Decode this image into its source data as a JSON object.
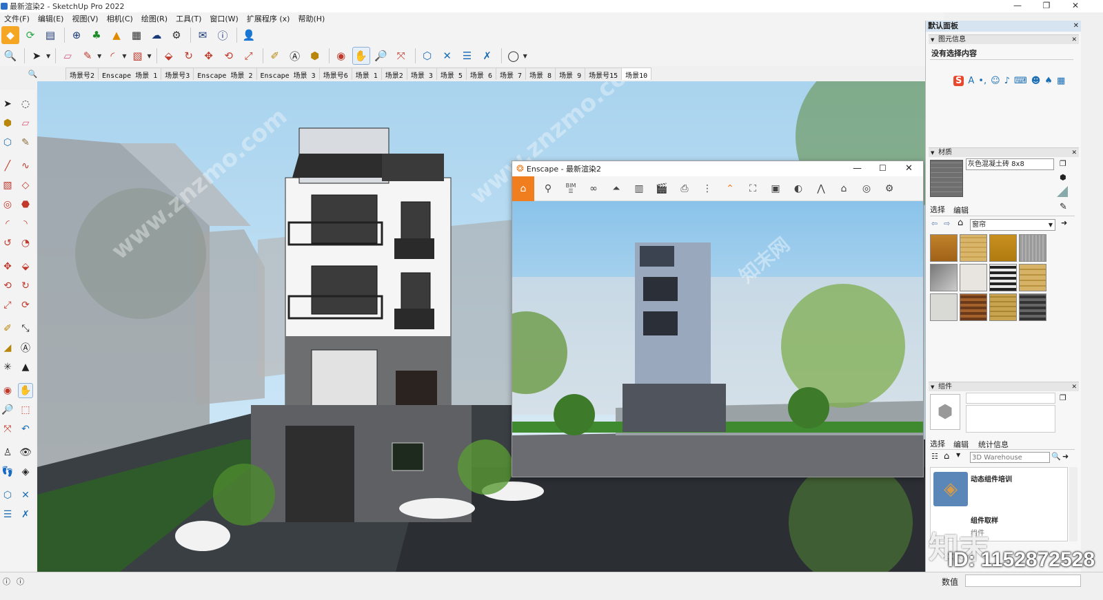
{
  "window": {
    "title": "最新渲染2 - SketchUp Pro 2022",
    "controls": [
      "—",
      "❐",
      "✕"
    ]
  },
  "menu": [
    "文件(F)",
    "编辑(E)",
    "视图(V)",
    "相机(C)",
    "绘图(R)",
    "工具(T)",
    "窗口(W)",
    "扩展程序 (x)",
    "帮助(H)"
  ],
  "scene_tabs": [
    "场景号2",
    "Enscape 场景 1",
    "场景号3",
    "Enscape 场景 2",
    "Enscape 场景 3",
    "场景号6",
    "场景 1",
    "场景2",
    "场景 3",
    "场景 5",
    "场景 6",
    "场景 7",
    "场景 8",
    "场景 9",
    "场景号15",
    "场景10"
  ],
  "active_scene_tab": "场景10",
  "enscape": {
    "title": "Enscape - 最新渲染2",
    "bim_label": "BIM"
  },
  "panel": {
    "title": "默认面板",
    "entity_info": {
      "header": "图元信息",
      "text": "没有选择内容"
    },
    "materials": {
      "header": "材质",
      "material_name": "灰色混凝土砖 8x8",
      "tab_select": "选择",
      "tab_edit": "编辑",
      "category": "窗帘"
    },
    "components": {
      "header": "组件",
      "tab_select": "选择",
      "tab_edit": "编辑",
      "tab_stats": "统计信息",
      "search_placeholder": "3D Warehouse",
      "item1": "动态组件培训",
      "item2": "组件取样",
      "item3": "组件"
    }
  },
  "status": {
    "value_label": "数值"
  },
  "watermark": {
    "id": "ID: 1152872528",
    "logo_text": "知末",
    "site": "www.znzmo.com",
    "site_cn": "知末网"
  },
  "colors": {
    "panel_title_bg": "#d6e4f2",
    "enscape_orange": "#f07d1e",
    "sky": "#bfe0f3"
  }
}
